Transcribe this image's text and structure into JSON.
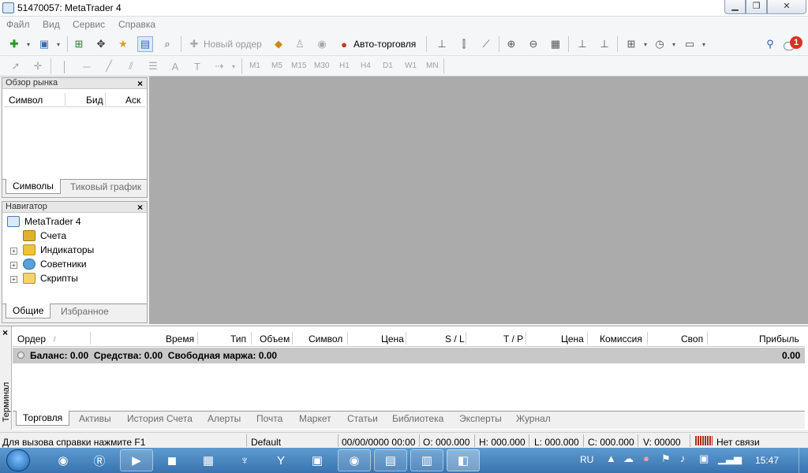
{
  "window": {
    "title": "51470057: MetaTrader 4"
  },
  "menu": [
    "Файл",
    "Вид",
    "Сервис",
    "Справка"
  ],
  "toolbar": {
    "new_order": "Новый ордер",
    "auto_trading": "Авто-торговля",
    "notification_count": "1"
  },
  "timeframes": [
    "M1",
    "M5",
    "M15",
    "M30",
    "H1",
    "H4",
    "D1",
    "W1",
    "MN"
  ],
  "market_watch": {
    "title": "Обзор рынка",
    "columns": [
      "Символ",
      "Бид",
      "Аск"
    ],
    "tabs": [
      "Символы",
      "Тиковый график"
    ]
  },
  "navigator": {
    "title": "Навигатор",
    "root": "MetaTrader 4",
    "items": [
      "Счета",
      "Индикаторы",
      "Советники",
      "Скрипты"
    ],
    "tabs": [
      "Общие",
      "Избранное"
    ]
  },
  "terminal": {
    "side_label": "Терминал",
    "columns": [
      "Ордер",
      "Время",
      "Тип",
      "Объем",
      "Символ",
      "Цена",
      "S / L",
      "T / P",
      "Цена",
      "Комиссия",
      "Своп",
      "Прибыль"
    ],
    "summary": "Баланс: 0.00  Средства: 0.00  Свободная маржа: 0.00",
    "profit": "0.00",
    "tabs": [
      "Торговля",
      "Активы",
      "История Счета",
      "Алерты",
      "Почта",
      "Маркет",
      "Статьи",
      "Библиотека",
      "Эксперты",
      "Журнал"
    ]
  },
  "status": {
    "help": "Для вызова справки нажмите F1",
    "profile": "Default",
    "datetime": "00/00/0000 00:00",
    "open": "O: 000.000",
    "high": "H: 000.000",
    "low": "L: 000.000",
    "close": "C: 000.000",
    "volume": "V: 00000",
    "connection": "Нет связи"
  },
  "taskbar": {
    "language": "RU",
    "clock": "15:47"
  }
}
